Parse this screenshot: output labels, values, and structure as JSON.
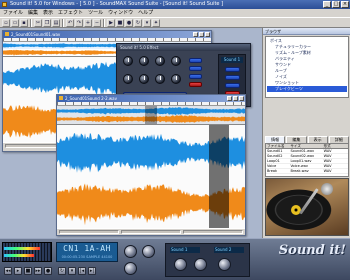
{
  "app": {
    "title": "Sound it! 5.0 for Windows - [ 5.0 ] - SoundMAX Sound Suite - [Sound it! Sound Suite ]",
    "menu": [
      "ファイル",
      "編集",
      "表示",
      "エフェクト",
      "ツール",
      "ウィンドウ",
      "ヘルプ"
    ]
  },
  "toolbar": {
    "buttons": [
      "new-icon",
      "open-icon",
      "save-icon",
      "cut-icon",
      "copy-icon",
      "paste-icon",
      "undo-icon",
      "redo-icon",
      "zoom-in-icon",
      "zoom-out-icon",
      "play-icon",
      "stop-icon",
      "record-icon",
      "loop-icon",
      "marker-icon",
      "effect-icon"
    ]
  },
  "windows": {
    "wave1": {
      "title": "2_Sound01Sound01.wav"
    },
    "wave2": {
      "title": "2_Sound01Sound 2-2.wav"
    }
  },
  "effect": {
    "title": "Sound it! 5.0 Effect",
    "preset": "Sound 1"
  },
  "right_panel": {
    "header": "ブラウザ",
    "tree": [
      {
        "label": "ボイス",
        "indent": false,
        "selected": false
      },
      {
        "label": "ナチュラリーカラー",
        "indent": true,
        "selected": false
      },
      {
        "label": "リズム・ループ素材",
        "indent": true,
        "selected": false
      },
      {
        "label": "バラエティ",
        "indent": true,
        "selected": false
      },
      {
        "label": "サウンド",
        "indent": true,
        "selected": false
      },
      {
        "label": "ループ",
        "indent": true,
        "selected": false
      },
      {
        "label": "ノイズ",
        "indent": true,
        "selected": false
      },
      {
        "label": "ワンショット",
        "indent": true,
        "selected": false
      },
      {
        "label": "ブレイクビーツ",
        "indent": true,
        "selected": true
      }
    ],
    "tabs": [
      "情報",
      "編集",
      "表示",
      "詳細"
    ],
    "table": {
      "columns": [
        "ファイル名",
        "サイズ",
        "形式"
      ],
      "rows": [
        [
          "Sound01",
          "Sound01.wav",
          "WAV"
        ],
        [
          "Sound02",
          "Sound02.wav",
          "WAV"
        ],
        [
          "Loop01",
          "Loop01.wav",
          "WAV"
        ],
        [
          "Voice",
          "Voice.wav",
          "WAV"
        ],
        [
          "Break",
          "Break.wav",
          "WAV"
        ]
      ]
    }
  },
  "transport": {
    "time": "CN1 1A-AH",
    "time_sub": "00:00:05.230 SAMPLE 44100",
    "brand": "Sound it!",
    "panel_label": "Sound 1",
    "panel_label2": "Sound 2"
  },
  "colors": {
    "wave_blue": "#1e8fe0",
    "wave_orange": "#f08a1a",
    "accent": "#2a5bd7"
  }
}
